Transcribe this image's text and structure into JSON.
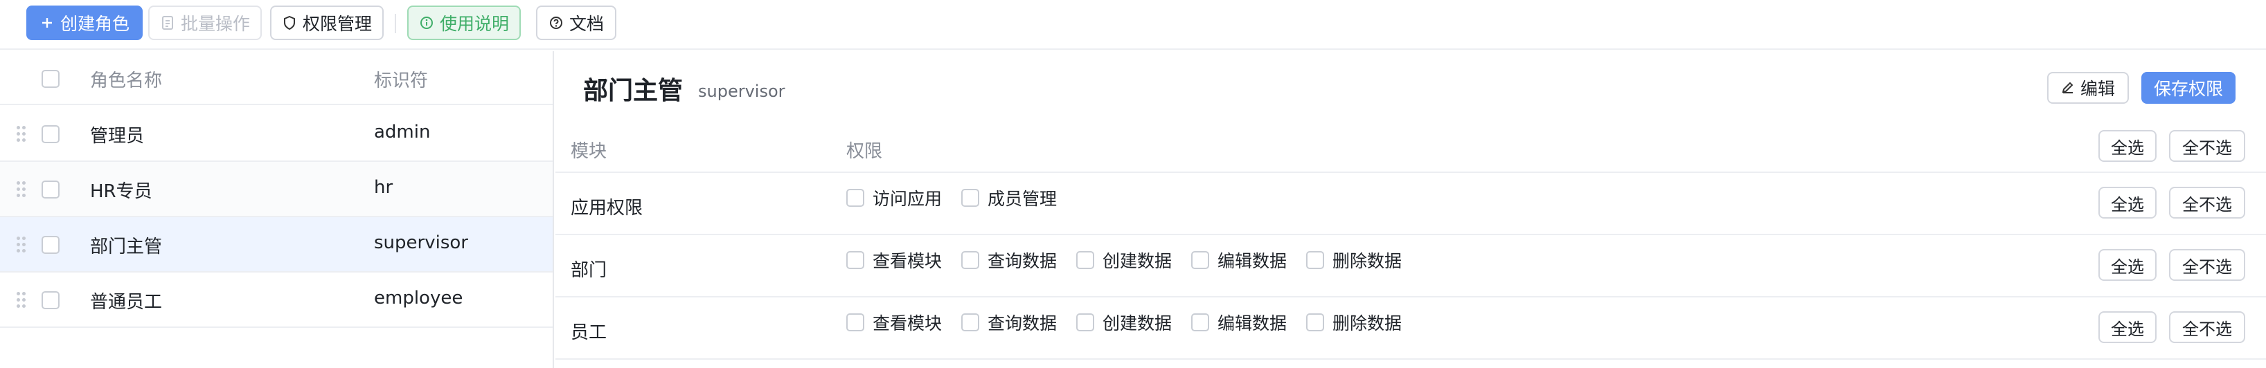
{
  "toolbar": {
    "create_label": "创建角色",
    "batch_label": "批量操作",
    "perm_manage_label": "权限管理",
    "usage_label": "使用说明",
    "docs_label": "文档"
  },
  "role_table": {
    "col_name": "角色名称",
    "col_id": "标识符",
    "rows": [
      {
        "name": "管理员",
        "id": "admin"
      },
      {
        "name": "HR专员",
        "id": "hr"
      },
      {
        "name": "部门主管",
        "id": "supervisor"
      },
      {
        "name": "普通员工",
        "id": "employee"
      }
    ],
    "selected_index": 2
  },
  "detail": {
    "title": "部门主管",
    "code": "supervisor",
    "edit_label": "编辑",
    "save_label": "保存权限",
    "col_module": "模块",
    "col_perm": "权限",
    "select_all": "全选",
    "select_none": "全不选",
    "modules": [
      {
        "name": "应用权限",
        "perms": [
          "访问应用",
          "成员管理"
        ]
      },
      {
        "name": "部门",
        "perms": [
          "查看模块",
          "查询数据",
          "创建数据",
          "编辑数据",
          "删除数据"
        ]
      },
      {
        "name": "员工",
        "perms": [
          "查看模块",
          "查询数据",
          "创建数据",
          "编辑数据",
          "删除数据"
        ]
      }
    ]
  },
  "colors": {
    "primary": "#5b8ff0",
    "success": "#3fae68",
    "selected_row": "#eef4ff"
  }
}
